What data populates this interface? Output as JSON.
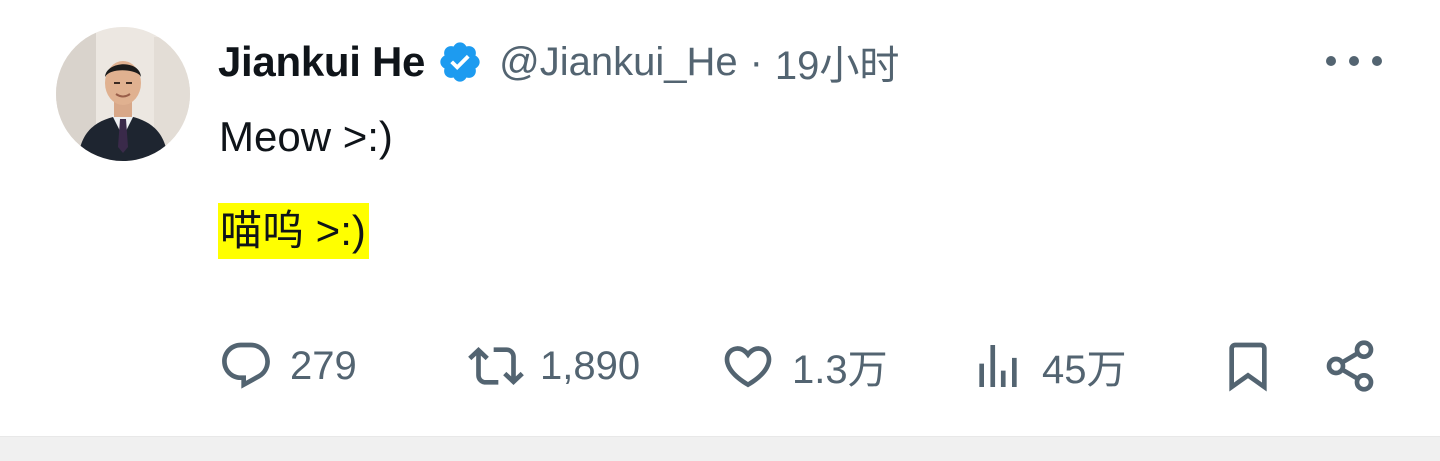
{
  "tweet": {
    "author": {
      "name": "Jiankui He",
      "handle": "@Jiankui_He",
      "verified": true
    },
    "separator": "·",
    "time": "19小时",
    "text_en": "Meow >:)",
    "text_zh": "喵呜 >:)",
    "highlight_color": "#ffff00",
    "verified_color": "#1d9bf0",
    "icon_color": "#536471",
    "actions": {
      "reply": {
        "icon": "comment-icon",
        "count": "279"
      },
      "retweet": {
        "icon": "retweet-icon",
        "count": "1,890"
      },
      "like": {
        "icon": "heart-icon",
        "count": "1.3万"
      },
      "views": {
        "icon": "bar-chart-icon",
        "count": "45万"
      },
      "bookmark": {
        "icon": "bookmark-icon"
      },
      "share": {
        "icon": "share-icon"
      }
    },
    "more_icon": "more-horizontal-icon"
  }
}
